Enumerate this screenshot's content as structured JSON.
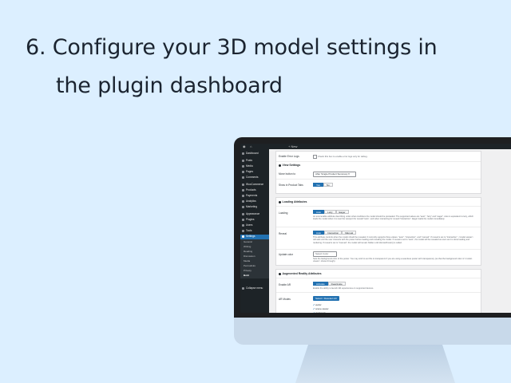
{
  "heading": {
    "line1": "6. Configure your 3D model settings in",
    "line2": "the plugin dashboard"
  },
  "admin_bar": {
    "new_label": "+ New"
  },
  "sidebar": {
    "items": [
      {
        "label": "Dashboard",
        "icon": "dashboard-icon"
      },
      {
        "label": "Posts",
        "icon": "pin-icon"
      },
      {
        "label": "Media",
        "icon": "media-icon"
      },
      {
        "label": "Pages",
        "icon": "page-icon"
      },
      {
        "label": "Comments",
        "icon": "comment-icon"
      },
      {
        "label": "WooCommerce",
        "icon": "woo-icon"
      },
      {
        "label": "Products",
        "icon": "product-icon"
      },
      {
        "label": "Payments",
        "icon": "payment-icon"
      },
      {
        "label": "Analytics",
        "icon": "chart-icon"
      },
      {
        "label": "Marketing",
        "icon": "megaphone-icon"
      },
      {
        "label": "Appearance",
        "icon": "brush-icon"
      },
      {
        "label": "Plugins",
        "icon": "plugin-icon"
      },
      {
        "label": "Users",
        "icon": "user-icon"
      },
      {
        "label": "Tools",
        "icon": "wrench-icon"
      },
      {
        "label": "Settings",
        "icon": "settings-icon"
      }
    ],
    "sub_items": [
      "General",
      "Writing",
      "Reading",
      "Discussion",
      "Media",
      "Permalinks",
      "Privacy",
      "Bold"
    ],
    "collapse_label": "Collapse menu"
  },
  "settings": {
    "enable_error_logs_label": "Enable Error Logs",
    "enable_error_logs_desc": "Check this box to enable error logs only for debug.",
    "view_settings_title": "View Settings",
    "move_button_label": "Move button to",
    "move_button_value": "After Single Product Summary",
    "show_in_product_tabs_label": "Show in Product Tabs",
    "show_in_product_tabs_options": [
      "Yes",
      "No"
    ],
    "loading_section_title": "Loading Attributes",
    "loading_label": "Loading",
    "loading_options": [
      "Auto",
      "Lazy",
      "Eager"
    ],
    "loading_desc": "An enumerable attribute describing under what conditions the model should be preloaded. The supported values are \"auto\", \"lazy\" and \"eager\". Auto is equivalent to lazy, which loads the model when it is near the viewport for reveal=\"auto\", and when interacting for reveal=\"interaction\". Eager loads the model immediately.",
    "reveal_label": "Reveal",
    "reveal_options": [
      "Auto",
      "Interaction",
      "Manual"
    ],
    "reveal_desc": "This attribute controls when the model should be revealed. It currently supports three values: \"auto\", \"interaction\", and \"manual\". If reveal is set to \"interaction\", <model-viewer> will wait until the user interacts with the poster before loading and revealing the model. If reveal is set to \"auto\", the model will be revealed as soon as it is done loading and rendering. If reveal is set to \"manual\", the model will remain hidden until dismissPoster() is called.",
    "poster_color_label": "Update color",
    "poster_color_value": "Select Color",
    "poster_color_desc": "Sets the background color of the poster. You may wish to set this to transparent if you are using a seamless poster with transparency (so that the background color of <model-viewer> shows through).",
    "ar_section_title": "Augmented Reality Attributes",
    "enable_ar_label": "Enable AR",
    "enable_ar_options": [
      "Activate",
      "Deactivate"
    ],
    "enable_ar_desc": "Enable the ability to launch AR experiences on supported devices.",
    "ar_modes_label": "AR Modes",
    "ar_modes_button": "Select / Deselect All",
    "ar_modes": [
      "webxr",
      "scene-viewer",
      "quick-look"
    ]
  },
  "colors": {
    "page_bg": "#dcefff",
    "wp_dark": "#1d2327",
    "wp_blue": "#2271b1"
  }
}
